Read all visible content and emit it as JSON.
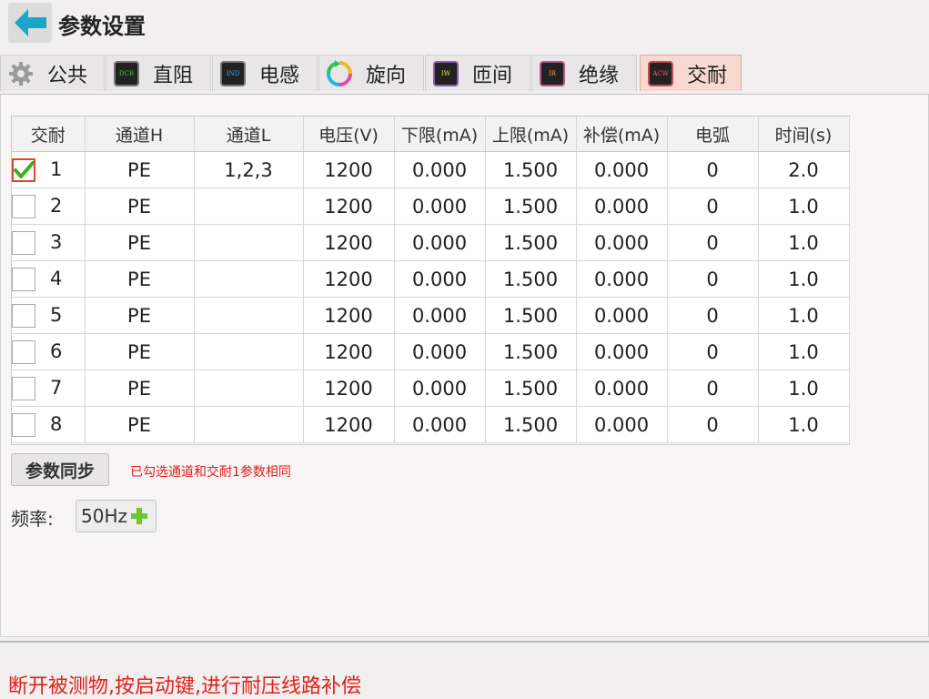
{
  "header": {
    "title": "参数设置"
  },
  "tabs": [
    {
      "label": "公共",
      "icon": "gear-icon",
      "chip_text": "",
      "chip_color": ""
    },
    {
      "label": "直阻",
      "icon": "dcr-chip-icon",
      "chip_text": "DCR",
      "chip_color": "#2fd32f"
    },
    {
      "label": "电感",
      "icon": "ind-chip-icon",
      "chip_text": "IND",
      "chip_color": "#3aa6ff"
    },
    {
      "label": "旋向",
      "icon": "rotation-icon",
      "chip_text": "",
      "chip_color": ""
    },
    {
      "label": "匝间",
      "icon": "iw-chip-icon",
      "chip_text": "IW",
      "chip_color": "#e5e52a"
    },
    {
      "label": "绝缘",
      "icon": "ir-chip-icon",
      "chip_text": "IR",
      "chip_color": "#ff9a3a"
    },
    {
      "label": "交耐",
      "icon": "acw-chip-icon",
      "chip_text": "ACW",
      "chip_color": "#ff5a5a",
      "active": true
    }
  ],
  "table": {
    "headers": [
      "交耐",
      "通道H",
      "通道L",
      "电压(V)",
      "下限(mA)",
      "上限(mA)",
      "补偿(mA)",
      "电弧",
      "时间(s)"
    ],
    "rows": [
      {
        "checked": true,
        "index": "1",
        "channel_h": "PE",
        "channel_l": "1,2,3",
        "voltage": "1200",
        "lower": "0.000",
        "upper": "1.500",
        "comp": "0.000",
        "arc": "0",
        "time": "2.0"
      },
      {
        "checked": false,
        "index": "2",
        "channel_h": "PE",
        "channel_l": "",
        "voltage": "1200",
        "lower": "0.000",
        "upper": "1.500",
        "comp": "0.000",
        "arc": "0",
        "time": "1.0"
      },
      {
        "checked": false,
        "index": "3",
        "channel_h": "PE",
        "channel_l": "",
        "voltage": "1200",
        "lower": "0.000",
        "upper": "1.500",
        "comp": "0.000",
        "arc": "0",
        "time": "1.0"
      },
      {
        "checked": false,
        "index": "4",
        "channel_h": "PE",
        "channel_l": "",
        "voltage": "1200",
        "lower": "0.000",
        "upper": "1.500",
        "comp": "0.000",
        "arc": "0",
        "time": "1.0"
      },
      {
        "checked": false,
        "index": "5",
        "channel_h": "PE",
        "channel_l": "",
        "voltage": "1200",
        "lower": "0.000",
        "upper": "1.500",
        "comp": "0.000",
        "arc": "0",
        "time": "1.0"
      },
      {
        "checked": false,
        "index": "6",
        "channel_h": "PE",
        "channel_l": "",
        "voltage": "1200",
        "lower": "0.000",
        "upper": "1.500",
        "comp": "0.000",
        "arc": "0",
        "time": "1.0"
      },
      {
        "checked": false,
        "index": "7",
        "channel_h": "PE",
        "channel_l": "",
        "voltage": "1200",
        "lower": "0.000",
        "upper": "1.500",
        "comp": "0.000",
        "arc": "0",
        "time": "1.0"
      },
      {
        "checked": false,
        "index": "8",
        "channel_h": "PE",
        "channel_l": "",
        "voltage": "1200",
        "lower": "0.000",
        "upper": "1.500",
        "comp": "0.000",
        "arc": "0",
        "time": "1.0"
      }
    ]
  },
  "sync": {
    "button_label": "参数同步",
    "note": "已勾选通道和交耐1参数相同"
  },
  "frequency": {
    "label": "频率:",
    "value": "50Hz"
  },
  "status": {
    "message": "断开被测物,按启动键,进行耐压线路补偿"
  },
  "colors": {
    "accent_back": "#1aa6c8",
    "active_tab": "#f8d9d2",
    "warning_text": "#e0201a",
    "check_green": "#3cb01c",
    "plus_green": "#6fc72e"
  }
}
